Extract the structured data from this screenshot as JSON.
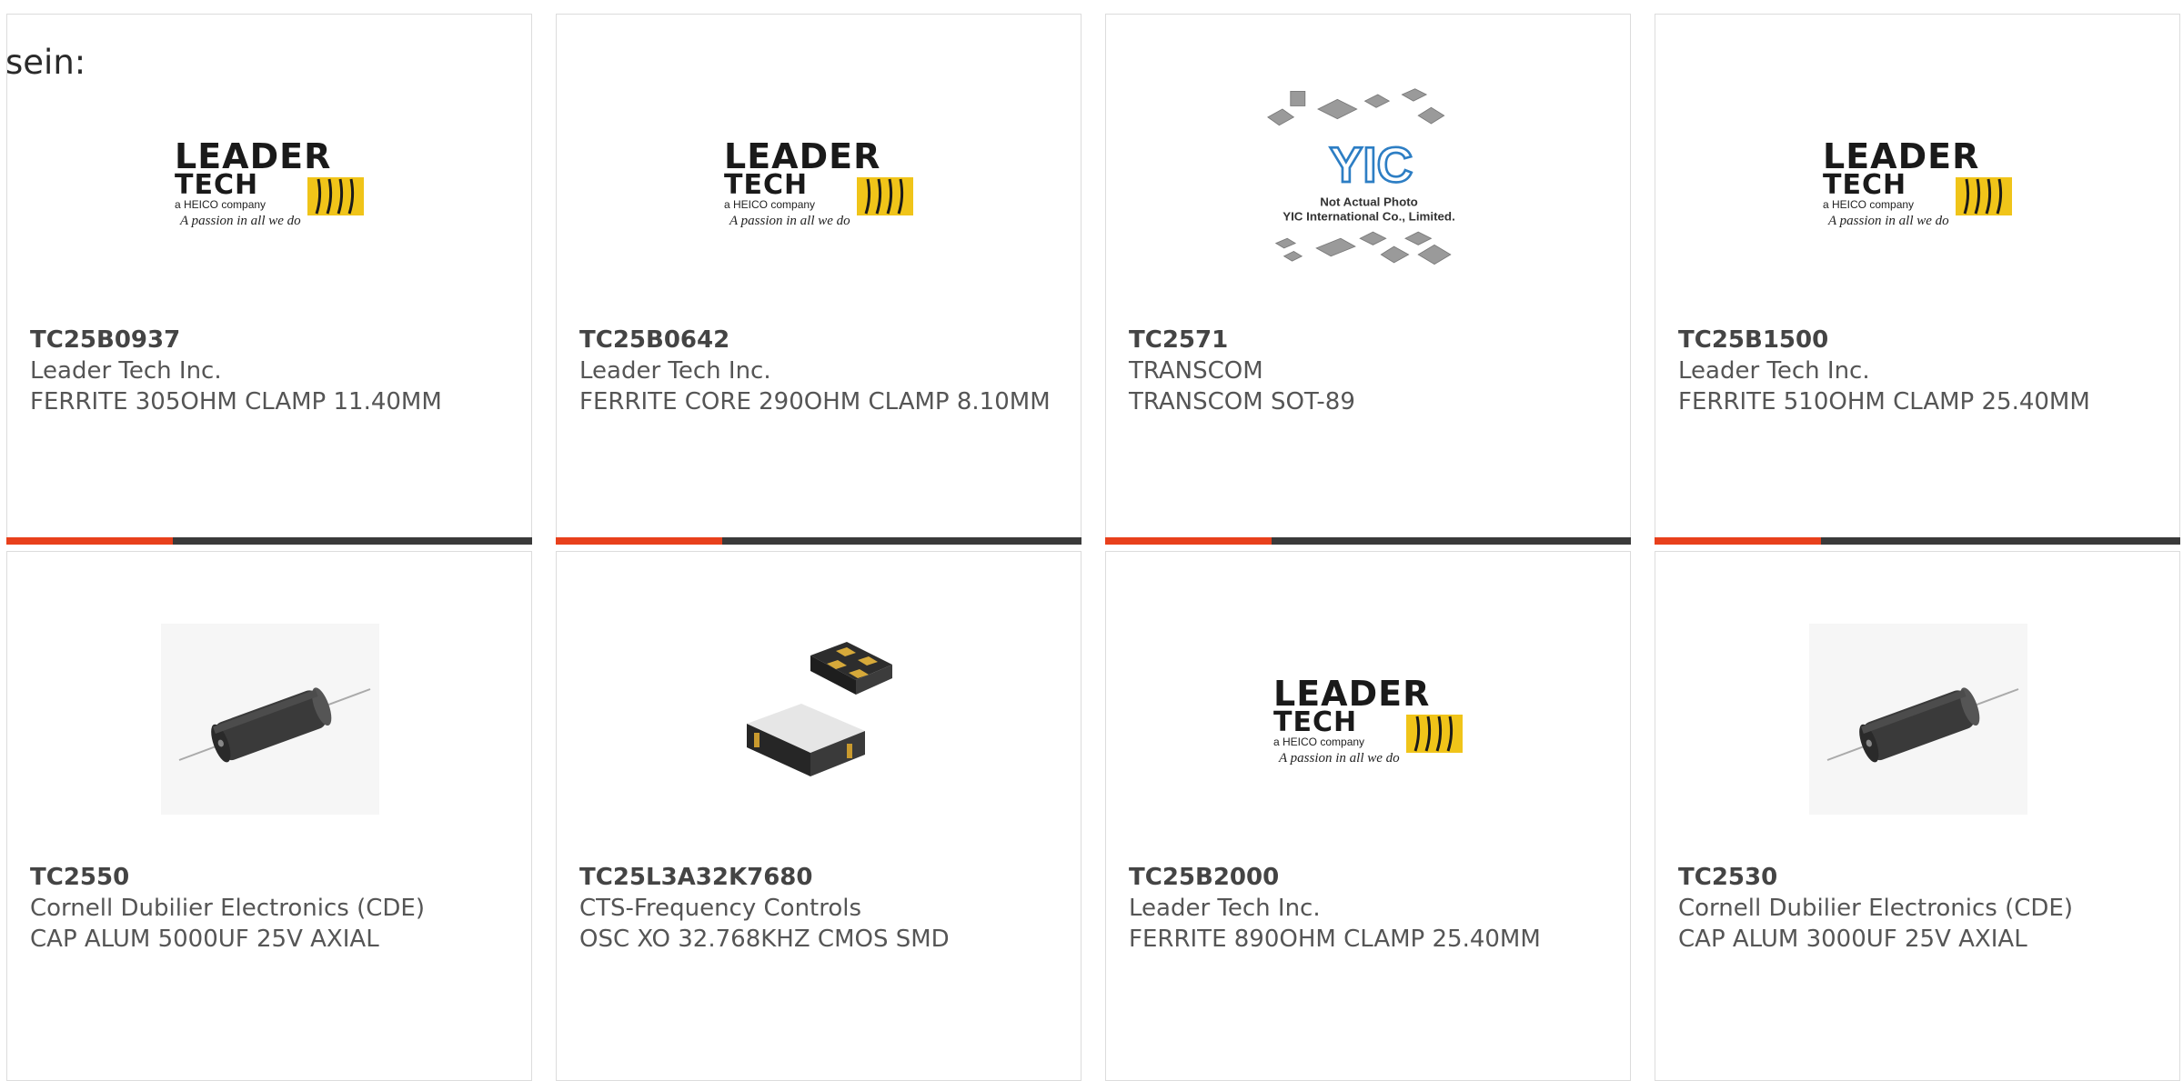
{
  "page": {
    "intro_text": "sein:"
  },
  "colors": {
    "accent": "#e8401c",
    "bar": "#3a3a3a",
    "border": "#dcdcdc",
    "logo_yellow": "#f0c419"
  },
  "logos": {
    "leader_tech": {
      "line1": "LEADER",
      "line2": "TECH",
      "tagline": "a HEICO company",
      "script": "A passion in all we do"
    },
    "yic": {
      "mark": "YIC",
      "line1": "Not Actual Photo",
      "line2": "YIC International Co., Limited."
    }
  },
  "products": [
    {
      "part_number": "TC25B0937",
      "manufacturer": "Leader Tech Inc.",
      "description": "FERRITE 305OHM CLAMP 11.40MM",
      "image": "leader-tech-logo"
    },
    {
      "part_number": "TC25B0642",
      "manufacturer": "Leader Tech Inc.",
      "description": "FERRITE CORE 290OHM CLAMP 8.10MM",
      "image": "leader-tech-logo"
    },
    {
      "part_number": "TC2571",
      "manufacturer": "TRANSCOM",
      "description": "TRANSCOM SOT-89",
      "image": "yic-not-actual-photo"
    },
    {
      "part_number": "TC25B1500",
      "manufacturer": "Leader Tech Inc.",
      "description": "FERRITE 510OHM CLAMP 25.40MM",
      "image": "leader-tech-logo"
    },
    {
      "part_number": "TC2550",
      "manufacturer": "Cornell Dubilier Electronics (CDE)",
      "description": "CAP ALUM 5000UF 25V AXIAL",
      "image": "axial-capacitor"
    },
    {
      "part_number": "TC25L3A32K7680",
      "manufacturer": "CTS-Frequency Controls",
      "description": "OSC XO 32.768KHZ CMOS SMD",
      "image": "smd-oscillator"
    },
    {
      "part_number": "TC25B2000",
      "manufacturer": "Leader Tech Inc.",
      "description": "FERRITE 890OHM CLAMP 25.40MM",
      "image": "leader-tech-logo"
    },
    {
      "part_number": "TC2530",
      "manufacturer": "Cornell Dubilier Electronics (CDE)",
      "description": "CAP ALUM 3000UF 25V AXIAL",
      "image": "axial-capacitor"
    }
  ]
}
